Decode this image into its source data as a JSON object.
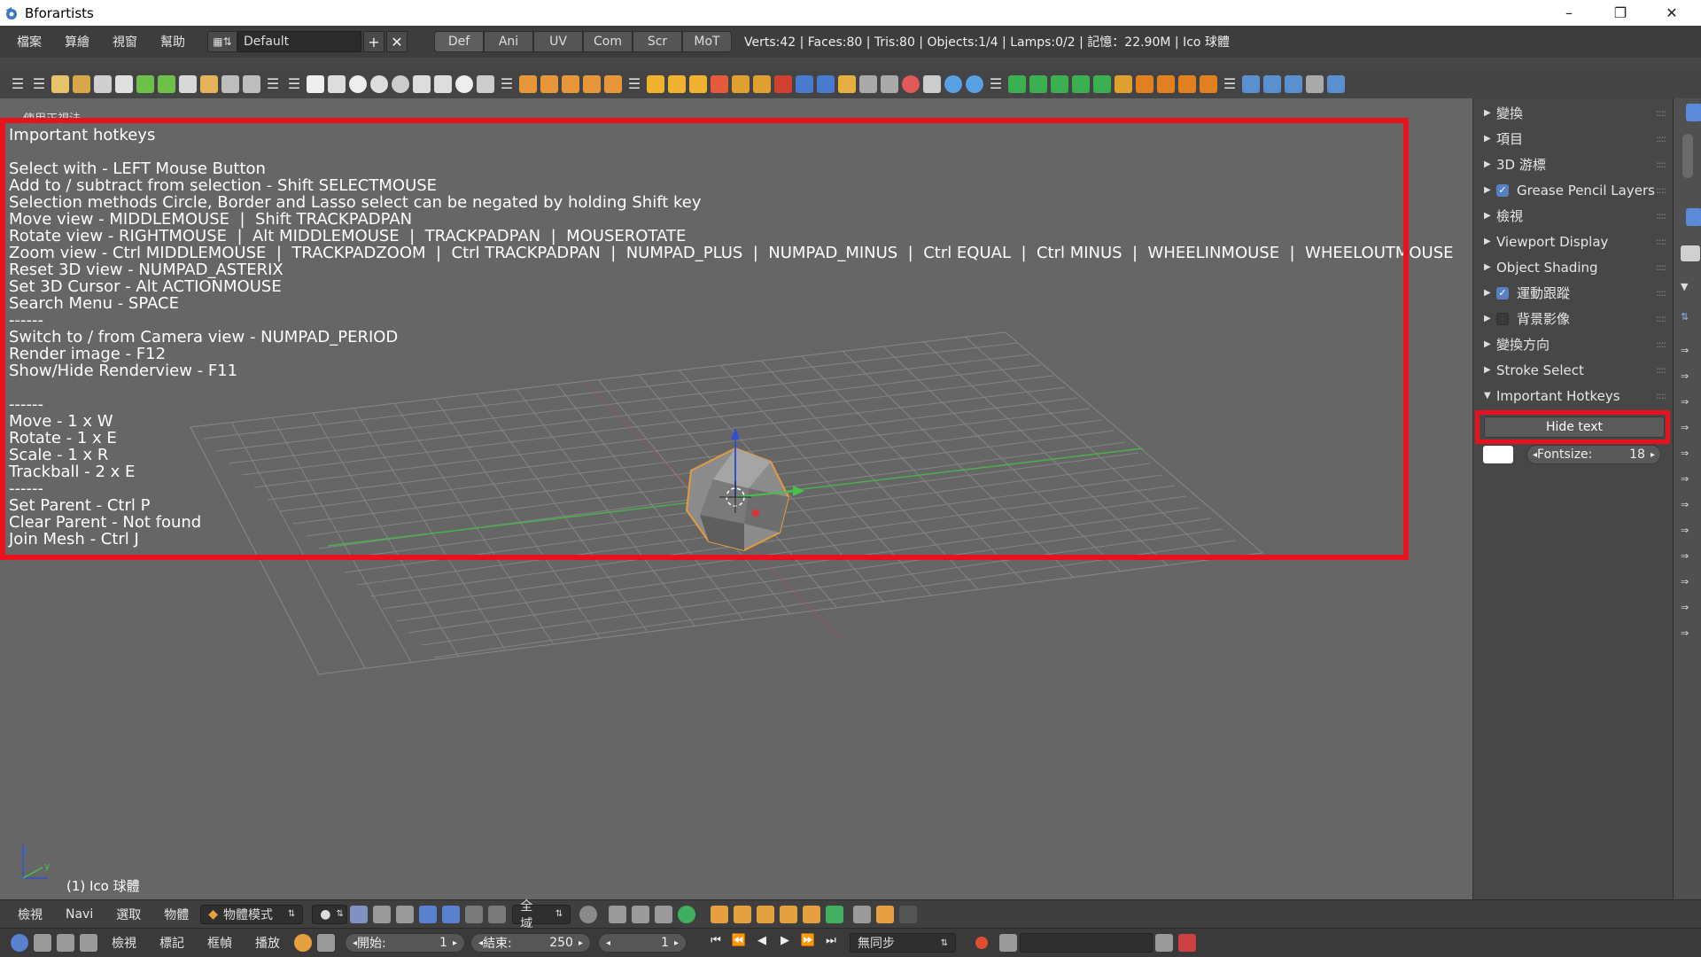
{
  "window": {
    "title": "Bforartists",
    "minimize": "–",
    "maximize": "❐",
    "close": "✕"
  },
  "menubar": {
    "items": [
      "檔案",
      "算繪",
      "視窗",
      "幫助"
    ],
    "layout_name": "Default",
    "add_label": "+",
    "remove_label": "✕",
    "workspace_tabs": [
      "Def",
      "Ani",
      "UV",
      "Com",
      "Scr",
      "MoT"
    ],
    "stats": "Verts:42 | Faces:80 | Tris:80 | Objects:1/4 | Lamps:0/2 | 記憶：22.90M | Ico 球體"
  },
  "viewport": {
    "label": "使用正視法",
    "object_label": "(1) Ico 球體",
    "hotkeys_text": "Important hotkeys\n\nSelect with - LEFT Mouse Button\nAdd to / subtract from selection - Shift SELECTMOUSE\nSelection methods Circle, Border and Lasso select can be negated by holding Shift key\nMove view - MIDDLEMOUSE  |  Shift TRACKPADPAN\nRotate view - RIGHTMOUSE  |  Alt MIDDLEMOUSE  |  TRACKPADPAN  |  MOUSEROTATE\nZoom view - Ctrl MIDDLEMOUSE  |  TRACKPADZOOM  |  Ctrl TRACKPADPAN  |  NUMPAD_PLUS  |  NUMPAD_MINUS  |  Ctrl EQUAL  |  Ctrl MINUS  |  WHEELINMOUSE  |  WHEELOUTMOUSE\nReset 3D view - NUMPAD_ASTERIX\nSet 3D Cursor - Alt ACTIONMOUSE\nSearch Menu - SPACE\n------\nSwitch to / from Camera view - NUMPAD_PERIOD\nRender image - F12\nShow/Hide Renderview - F11\n\n------\nMove - 1 x W\nRotate - 1 x E\nScale - 1 x R\nTrackball - 2 x E\n------\nSet Parent - Ctrl P\nClear Parent - Not found\nJoin Mesh - Ctrl J",
    "axis_z": "z",
    "axis_y": "y"
  },
  "properties": {
    "panels": [
      {
        "label": "變換",
        "open": false,
        "checkbox": null
      },
      {
        "label": "項目",
        "open": false,
        "checkbox": null
      },
      {
        "label": "3D 游標",
        "open": false,
        "checkbox": null
      },
      {
        "label": "Grease Pencil Layers",
        "open": false,
        "checkbox": true
      },
      {
        "label": "檢視",
        "open": false,
        "checkbox": null
      },
      {
        "label": "Viewport Display",
        "open": false,
        "checkbox": null
      },
      {
        "label": "Object Shading",
        "open": false,
        "checkbox": null
      },
      {
        "label": "運動跟蹤",
        "open": false,
        "checkbox": true
      },
      {
        "label": "背景影像",
        "open": false,
        "checkbox": false
      },
      {
        "label": "變換方向",
        "open": false,
        "checkbox": null
      },
      {
        "label": "Stroke Select",
        "open": false,
        "checkbox": null
      },
      {
        "label": "Important Hotkeys",
        "open": true,
        "checkbox": null
      }
    ],
    "hide_text_label": "Hide text",
    "fontsize_label": "Fontsize:",
    "fontsize_value": "18"
  },
  "header_bottom": {
    "items": [
      "檢視",
      "Navi",
      "選取",
      "物體"
    ],
    "mode": "物體模式",
    "scope": "全域"
  },
  "timeline": {
    "items": [
      "檢視",
      "標記",
      "框幀",
      "播放"
    ],
    "start_label": "開始:",
    "start_value": "1",
    "end_label": "結束:",
    "end_value": "250",
    "current_frame": "1",
    "sync": "無同步"
  },
  "colors": {
    "highlight": "#e8121f",
    "accent": "#5680c2"
  }
}
